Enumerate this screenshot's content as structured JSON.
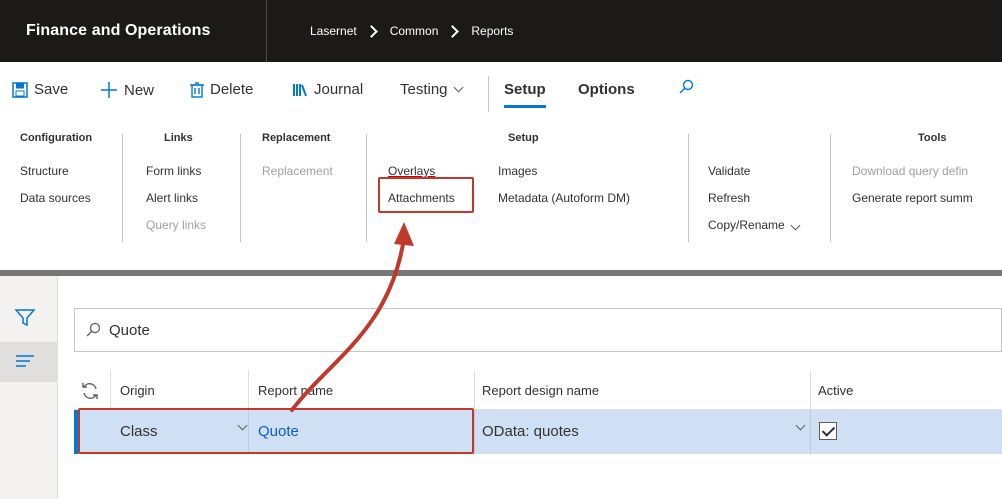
{
  "topbar": {
    "app_title": "Finance and Operations",
    "breadcrumb": [
      "Lasernet",
      "Common",
      "Reports"
    ]
  },
  "actions": {
    "save": "Save",
    "new": "New",
    "delete": "Delete",
    "journal": "Journal",
    "testing": "Testing",
    "setup": "Setup",
    "options": "Options"
  },
  "ribbon": {
    "configuration": {
      "title": "Configuration",
      "items": [
        "Structure",
        "Data sources"
      ]
    },
    "links": {
      "title": "Links",
      "items": [
        "Form links",
        "Alert links",
        "Query links"
      ]
    },
    "replacement": {
      "title": "Replacement",
      "items": [
        "Replacement"
      ]
    },
    "setup": {
      "title": "Setup",
      "items": [
        "Overlays",
        "Attachments",
        "Images",
        "Metadata (Autoform DM)"
      ]
    },
    "validate_group": {
      "items": [
        "Validate",
        "Refresh",
        "Copy/Rename"
      ]
    },
    "tools": {
      "title": "Tools",
      "items": [
        "Download query defin",
        "Generate report summ"
      ]
    }
  },
  "search": {
    "value": "Quote"
  },
  "grid": {
    "columns": [
      "Origin",
      "Report name",
      "Report design name",
      "Active"
    ],
    "rows": [
      {
        "origin": "Class",
        "report_name": "Quote",
        "report_design_name": "OData: quotes",
        "active": true
      }
    ]
  },
  "colors": {
    "accent": "#0078d4",
    "highlight": "#c0392b",
    "selected_row": "#cfe0f5",
    "topbar": "#1b1a19"
  }
}
